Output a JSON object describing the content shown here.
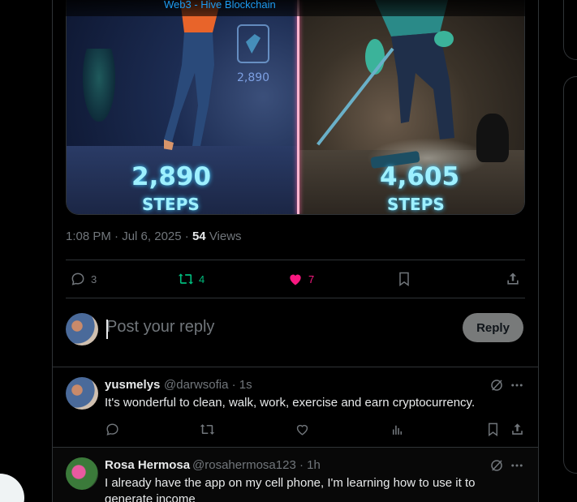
{
  "header": {
    "partial_text": "Web3 - Hive Blockchain"
  },
  "media": {
    "left_holo_value": "2,890",
    "left_steps_value": "2,890",
    "left_steps_label": "STEPS",
    "right_steps_value": "4,605",
    "right_steps_label": "STEPS"
  },
  "post_meta": {
    "time": "1:08 PM",
    "date": "Jul 6, 2025",
    "views_count": "54",
    "views_label": "Views"
  },
  "actions": {
    "replies": "3",
    "reposts": "4",
    "likes": "7"
  },
  "composer": {
    "placeholder": "Post your reply",
    "reply_button": "Reply"
  },
  "replies": [
    {
      "name": "yusmelys",
      "handle": "@darwsofia",
      "time": "1s",
      "text": "It's wonderful to clean, walk, work, exercise and earn cryptocurrency."
    },
    {
      "name": "Rosa Hermosa",
      "handle": "@rosahermosa123",
      "time": "1h",
      "text": "I already have the app on my cell phone, I'm learning how to use it to generate income"
    }
  ],
  "colors": {
    "background": "#000000",
    "border": "#2f3336",
    "muted": "#71767b",
    "repost_green": "#00ba7c",
    "like_pink": "#f91880",
    "link_blue": "#1d9bf0"
  },
  "icons": {
    "reply": "speech-bubble-icon",
    "repost": "repost-arrows-icon",
    "like": "heart-icon",
    "bookmark": "bookmark-icon",
    "share": "share-upload-icon",
    "grok": "grok-icon",
    "more": "more-dots-icon",
    "analytics": "bar-chart-icon"
  }
}
